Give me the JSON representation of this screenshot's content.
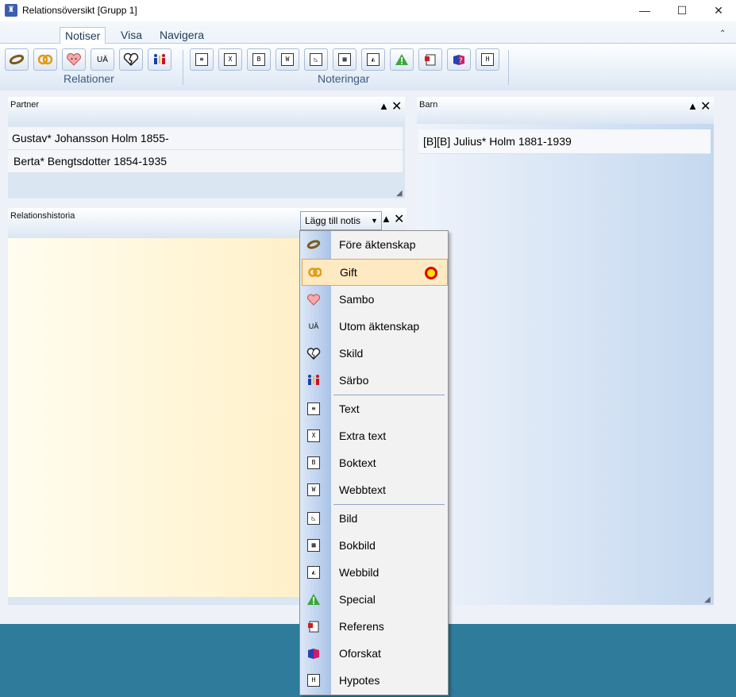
{
  "window": {
    "title": "Relationsöversikt [Grupp 1]",
    "minimize": "—",
    "maximize": "☐",
    "close": "✕"
  },
  "ribbon": {
    "tabs": [
      "Notiser",
      "Visa",
      "Navigera"
    ],
    "groups": {
      "relationer": "Relationer",
      "noteringar": "Noteringar"
    },
    "relation_buttons": [
      "ring-icon",
      "married-rings-icon",
      "heart-face-icon",
      "ua-icon",
      "broken-heart-icon",
      "separate-people-icon"
    ],
    "note_buttons": [
      "text-icon",
      "extra-text-icon",
      "book-text-icon",
      "web-text-icon",
      "image-icon",
      "book-image-icon",
      "web-image-icon",
      "special-warning-icon",
      "reference-icon",
      "unknown-icon",
      "hypothesis-icon"
    ],
    "ua_text": "UÄ"
  },
  "partner": {
    "title": "Partner",
    "rows": [
      "Gustav*  Johansson  Holm  1855-",
      "Berta*  Bengtsdotter  1854-1935"
    ]
  },
  "barn": {
    "title": "Barn",
    "rows": [
      "[B][B] Julius* Holm 1881-1939"
    ]
  },
  "historia": {
    "title": "Relationshistoria",
    "add_note": "Lägg till notis"
  },
  "menu": {
    "items": [
      {
        "label": "Före äktenskap",
        "icon": "ring-icon"
      },
      {
        "label": "Gift",
        "icon": "married-rings-icon"
      },
      {
        "label": "Sambo",
        "icon": "heart-face-icon"
      },
      {
        "label": "Utom äktenskap",
        "icon": "ua-icon"
      },
      {
        "label": "Skild",
        "icon": "broken-heart-icon"
      },
      {
        "label": "Särbo",
        "icon": "separate-people-icon"
      },
      {
        "label": "Text",
        "icon": "text-icon"
      },
      {
        "label": "Extra text",
        "icon": "extra-text-icon"
      },
      {
        "label": "Boktext",
        "icon": "book-text-icon"
      },
      {
        "label": "Webbtext",
        "icon": "web-text-icon"
      },
      {
        "label": "Bild",
        "icon": "image-icon"
      },
      {
        "label": "Bokbild",
        "icon": "book-image-icon"
      },
      {
        "label": "Webbild",
        "icon": "web-image-icon"
      },
      {
        "label": "Special",
        "icon": "special-warning-icon"
      },
      {
        "label": "Referens",
        "icon": "reference-icon"
      },
      {
        "label": "Oforskat",
        "icon": "unknown-icon"
      },
      {
        "label": "Hypotes",
        "icon": "hypothesis-icon"
      }
    ],
    "highlighted": "Gift"
  },
  "colors": {
    "accent": "#1e395b",
    "highlight": "#fde9c2",
    "background": "#2e7b9b"
  }
}
